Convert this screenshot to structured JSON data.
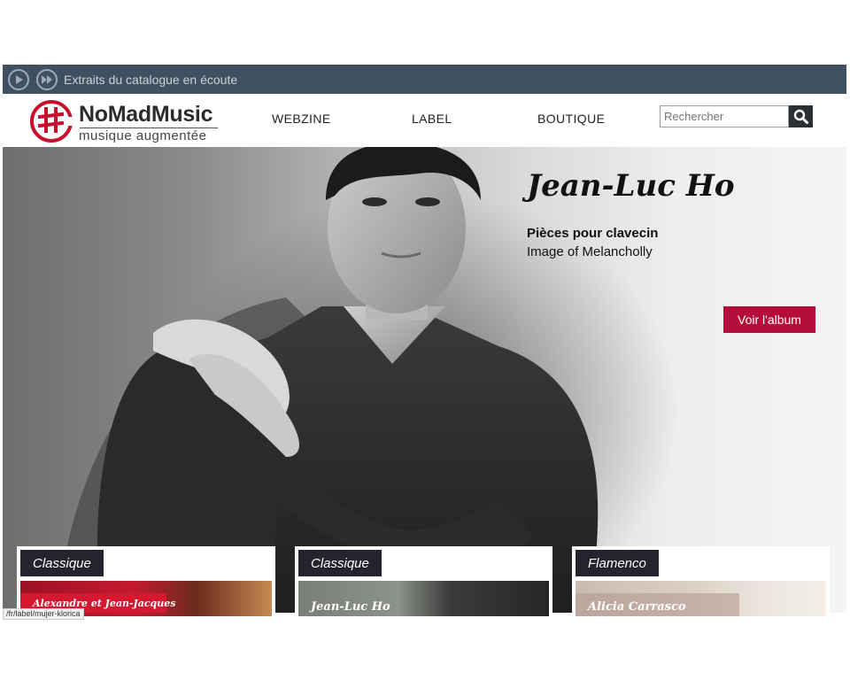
{
  "player": {
    "text": "Extraits du catalogue en écoute",
    "play_icon": "play-icon",
    "next_icon": "fast-forward-icon"
  },
  "header": {
    "brand": "NoMadMusic",
    "tagline": "musique augmentée",
    "nav": [
      "WEBZINE",
      "LABEL",
      "BOUTIQUE"
    ],
    "search_placeholder": "Rechercher",
    "accent_color": "#c8102e"
  },
  "hero": {
    "artist": "Jean-Luc Ho",
    "work": "Pièces pour clavecin",
    "album": "Image of Melancholly",
    "cta": "Voir l'album",
    "cta_color": "#b40d3a"
  },
  "cards": [
    {
      "tag": "Classique",
      "image_label": "Alexandre et Jean-Jacques"
    },
    {
      "tag": "Classique",
      "image_label": "Jean-Luc Ho"
    },
    {
      "tag": "Flamenco",
      "image_label": "Alicia Carrasco"
    }
  ],
  "status_url": "/fr/label/mujer-klorica"
}
